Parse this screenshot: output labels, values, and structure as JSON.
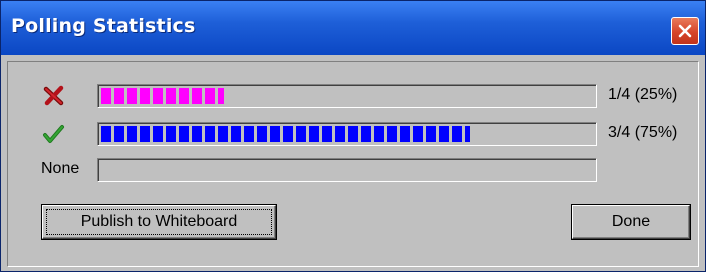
{
  "window": {
    "title": "Polling Statistics"
  },
  "rows": [
    {
      "icon": "red-x-icon",
      "label": "",
      "fraction": 0.25,
      "value_text": "1/4 (25%)",
      "color": "#ff00ff"
    },
    {
      "icon": "green-check-icon",
      "label": "",
      "fraction": 0.75,
      "value_text": "3/4 (75%)",
      "color": "#0000ff"
    },
    {
      "icon": "",
      "label": "None",
      "fraction": 0,
      "value_text": "",
      "color": "#0000ff"
    }
  ],
  "buttons": {
    "publish_label": "Publish to Whiteboard",
    "done_label": "Done"
  },
  "colors": {
    "titlebar": "#0b47c4",
    "dialog_face": "#c0c0c0",
    "close_button": "#d6452a"
  }
}
